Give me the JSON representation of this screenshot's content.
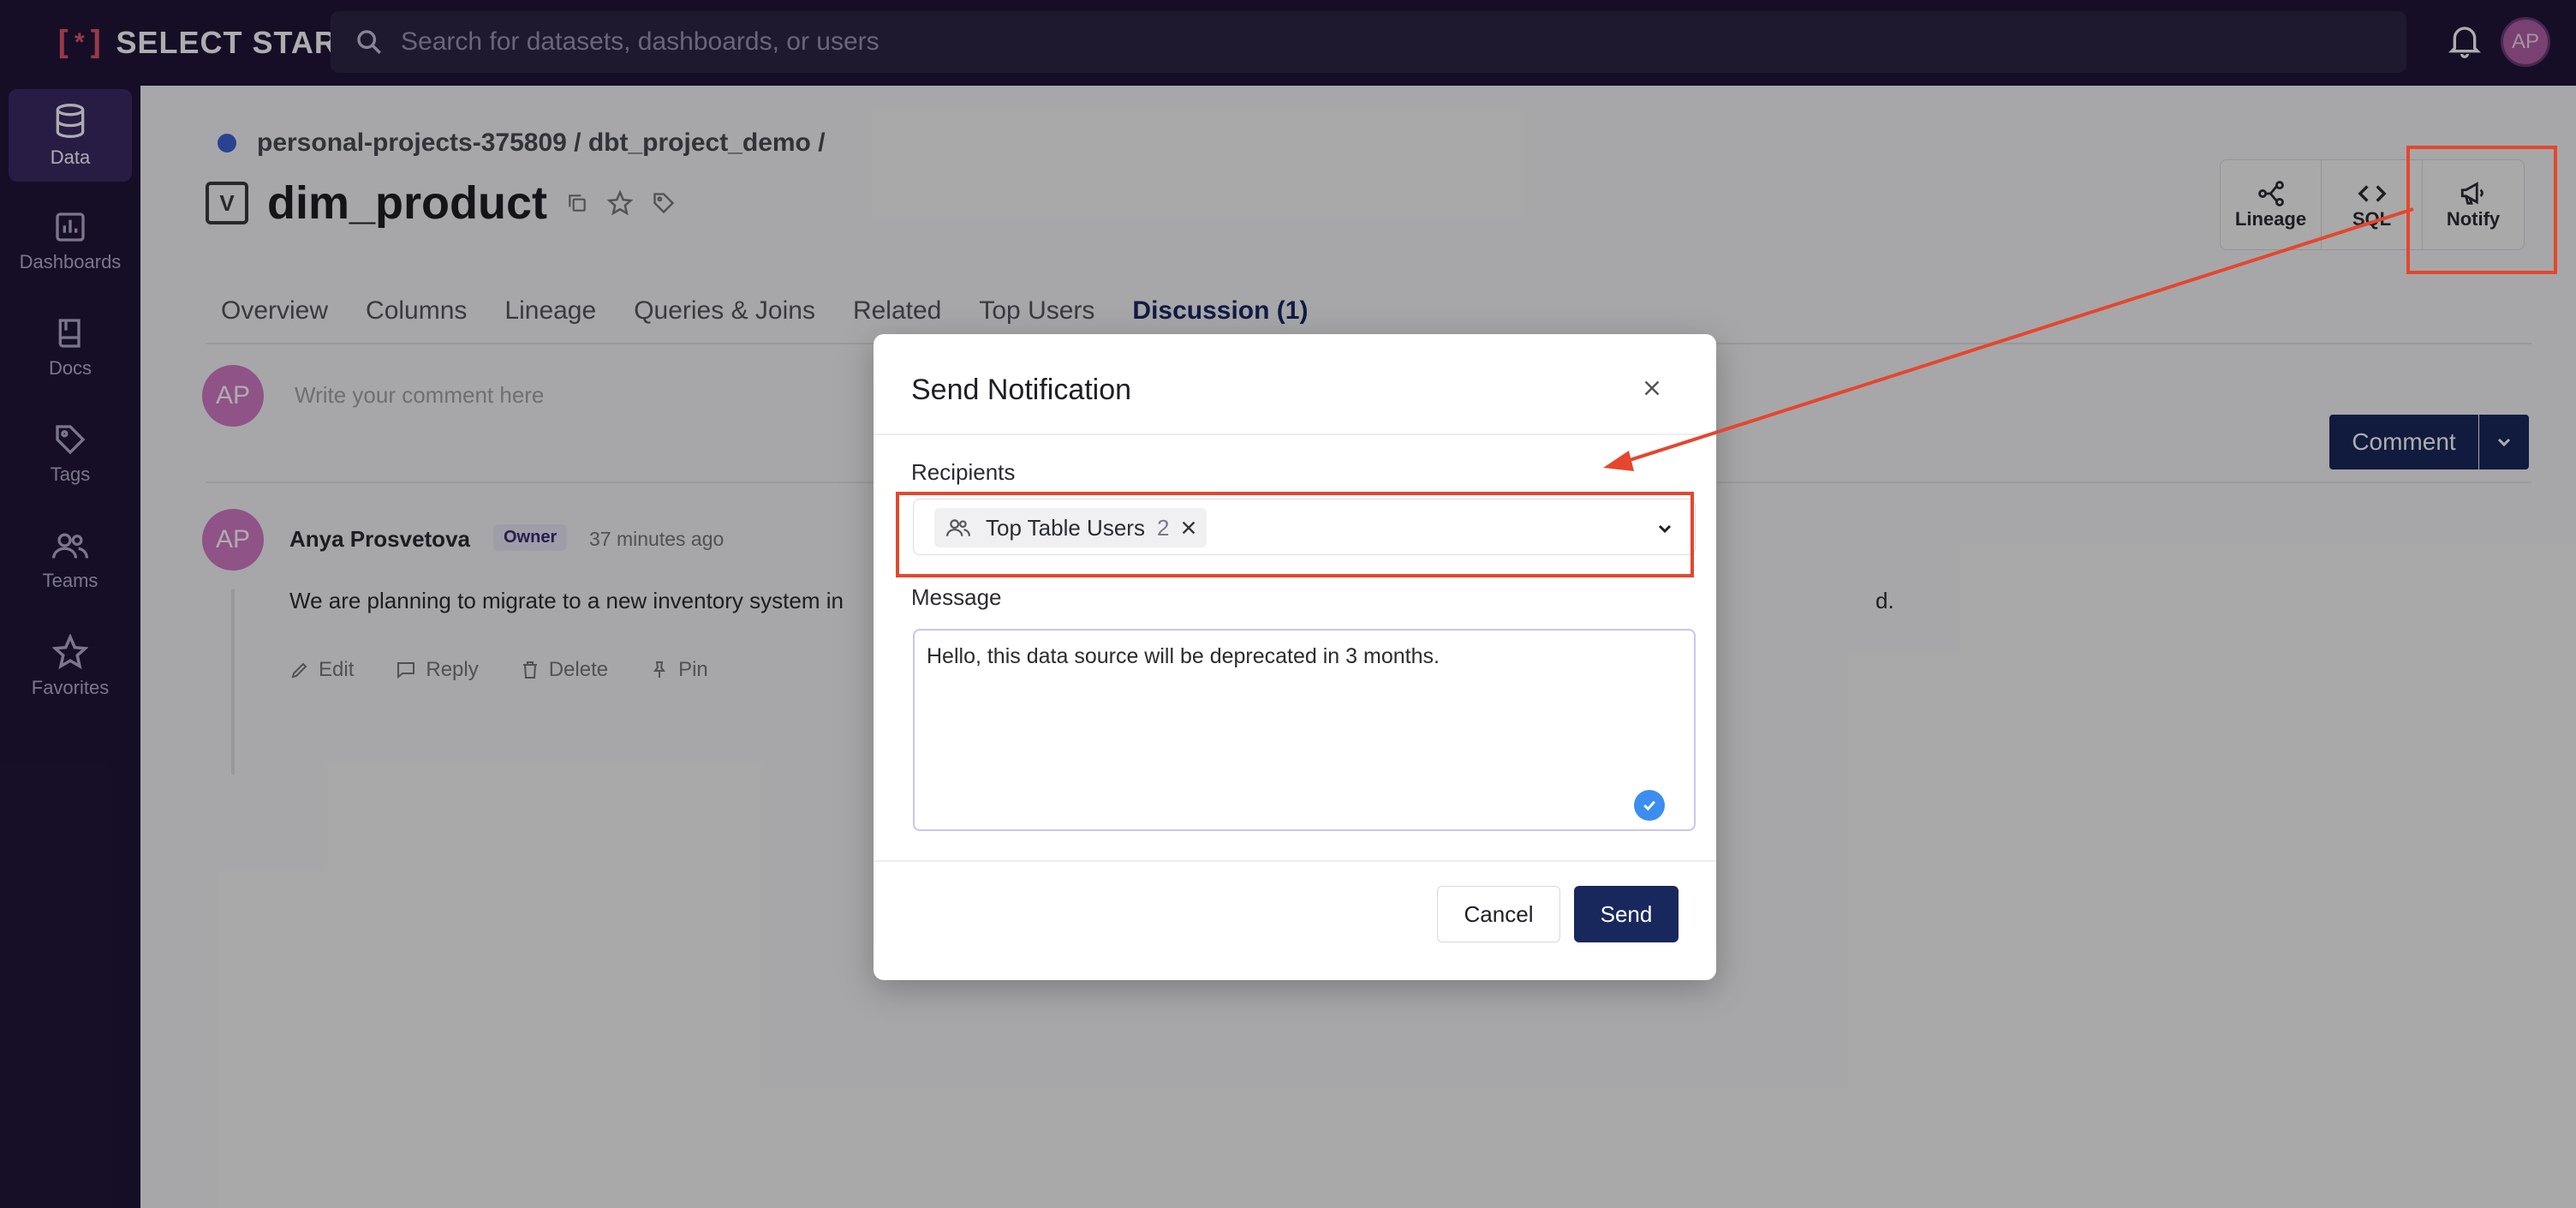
{
  "app": {
    "logo_bracket_left": "[",
    "logo_star": "*",
    "logo_bracket_right": "]",
    "logo_text": "SELECT STAR",
    "search_placeholder": "Search for datasets, dashboards, or users",
    "user_initials": "AP"
  },
  "sidebar": {
    "items": [
      {
        "label": "Data",
        "icon": "database-icon",
        "active": true
      },
      {
        "label": "Dashboards",
        "icon": "bar-chart-icon",
        "active": false
      },
      {
        "label": "Docs",
        "icon": "book-icon",
        "active": false
      },
      {
        "label": "Tags",
        "icon": "tag-icon",
        "active": false
      },
      {
        "label": "Teams",
        "icon": "users-icon",
        "active": false
      },
      {
        "label": "Favorites",
        "icon": "star-icon",
        "active": false
      }
    ]
  },
  "page": {
    "breadcrumb": "personal-projects-375809 / dbt_project_demo /",
    "title": "dim_product",
    "table_icon_letter": "V",
    "actions": [
      {
        "label": "Lineage",
        "icon": "lineage-icon"
      },
      {
        "label": "SQL",
        "icon": "code-icon"
      },
      {
        "label": "Notify",
        "icon": "megaphone-icon"
      }
    ],
    "tabs": [
      "Overview",
      "Columns",
      "Lineage",
      "Queries & Joins",
      "Related",
      "Top Users",
      "Discussion (1)"
    ],
    "active_tab": "Discussion (1)"
  },
  "discussion": {
    "avatar_initials": "AP",
    "input_placeholder": "Write your comment here",
    "comment_button": "Comment",
    "comment": {
      "author": "Anya Prosvetova",
      "badge": "Owner",
      "time": "37 minutes ago",
      "text_start": "We are planning to migrate to a new inventory system in ",
      "text_end": "d.",
      "actions": [
        "Edit",
        "Reply",
        "Delete",
        "Pin"
      ]
    }
  },
  "modal": {
    "title": "Send Notification",
    "recipients_label": "Recipients",
    "chip_label": "Top Table Users",
    "chip_count": "2",
    "message_label": "Message",
    "message_value": "Hello, this data source will be deprecated in 3 months.",
    "cancel": "Cancel",
    "send": "Send"
  },
  "colors": {
    "nav_bg": "#21163a",
    "primary": "#18285c",
    "annotation": "#e4472e",
    "avatar": "#d37bc7"
  }
}
